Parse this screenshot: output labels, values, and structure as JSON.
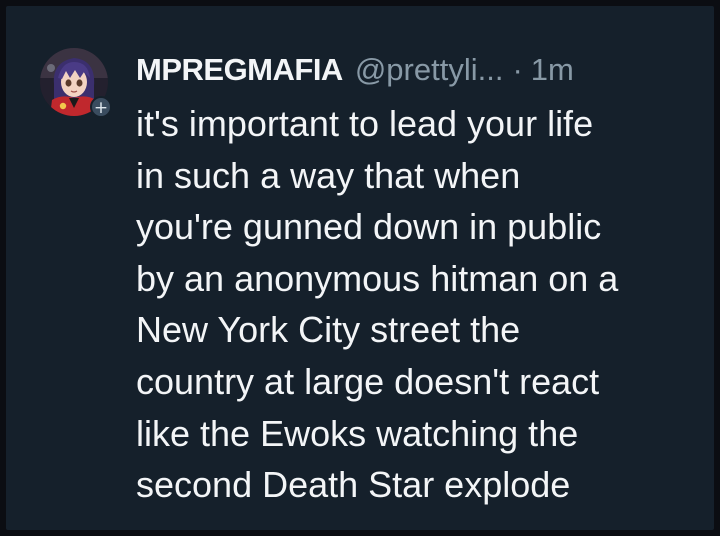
{
  "post": {
    "display_name": "MPREGMAFIA",
    "handle": "@prettyli...",
    "separator": "·",
    "time": "1m",
    "follow_badge": "+",
    "avatar_icon": "anime-character-avatar-icon",
    "text_lines": [
      "it's important to lead your life",
      "in such a way that when",
      "you're gunned down in public",
      "by an anonymous hitman on a",
      "New York City street the",
      "country at large doesn't react",
      "like the Ewoks watching the",
      "second Death Star explode"
    ]
  },
  "colors": {
    "background": "#15202b",
    "text": "#f3f5f7",
    "muted": "#8899a6"
  }
}
